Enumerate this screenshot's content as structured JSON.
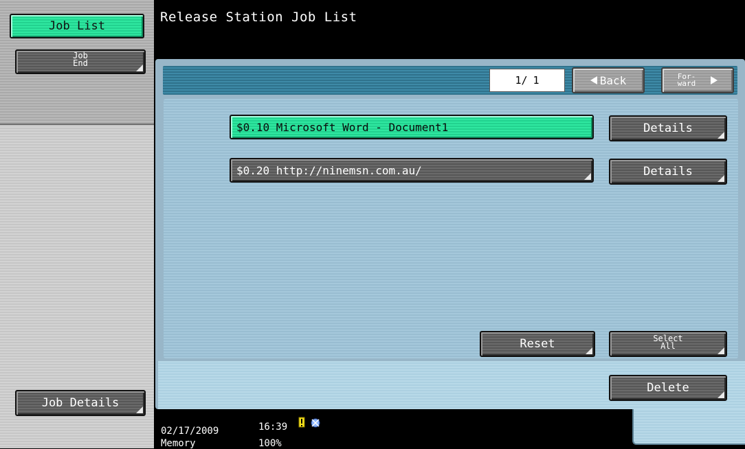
{
  "sidebar": {
    "job_list_label": "Job List",
    "job_end_label_line1": "Job",
    "job_end_label_line2": "End",
    "job_details_label": "Job Details"
  },
  "header": {
    "title": "Release Station Job List"
  },
  "pagination": {
    "current": "1/",
    "total": "1",
    "back_label": "Back",
    "forward_line1": "For-",
    "forward_line2": "ward"
  },
  "jobs": [
    {
      "label": "$0.10 Microsoft Word - Document1",
      "selected": true,
      "details_label": "Details"
    },
    {
      "label": "$0.20 http://ninemsn.com.au/",
      "selected": false,
      "details_label": "Details"
    }
  ],
  "actions": {
    "reset_label": "Reset",
    "select_all_line1": "Select",
    "select_all_line2": "All",
    "delete_label": "Delete"
  },
  "status_bar": {
    "date": "02/17/2009",
    "time": "16:39",
    "memory_label": "Memory",
    "memory_value": "100%",
    "icons": [
      "warning-icon",
      "network-icon"
    ]
  },
  "colors": {
    "selected_green": "#2fe7a0",
    "header_blue": "#2f728c",
    "panel_blue": "#a5c8db"
  }
}
